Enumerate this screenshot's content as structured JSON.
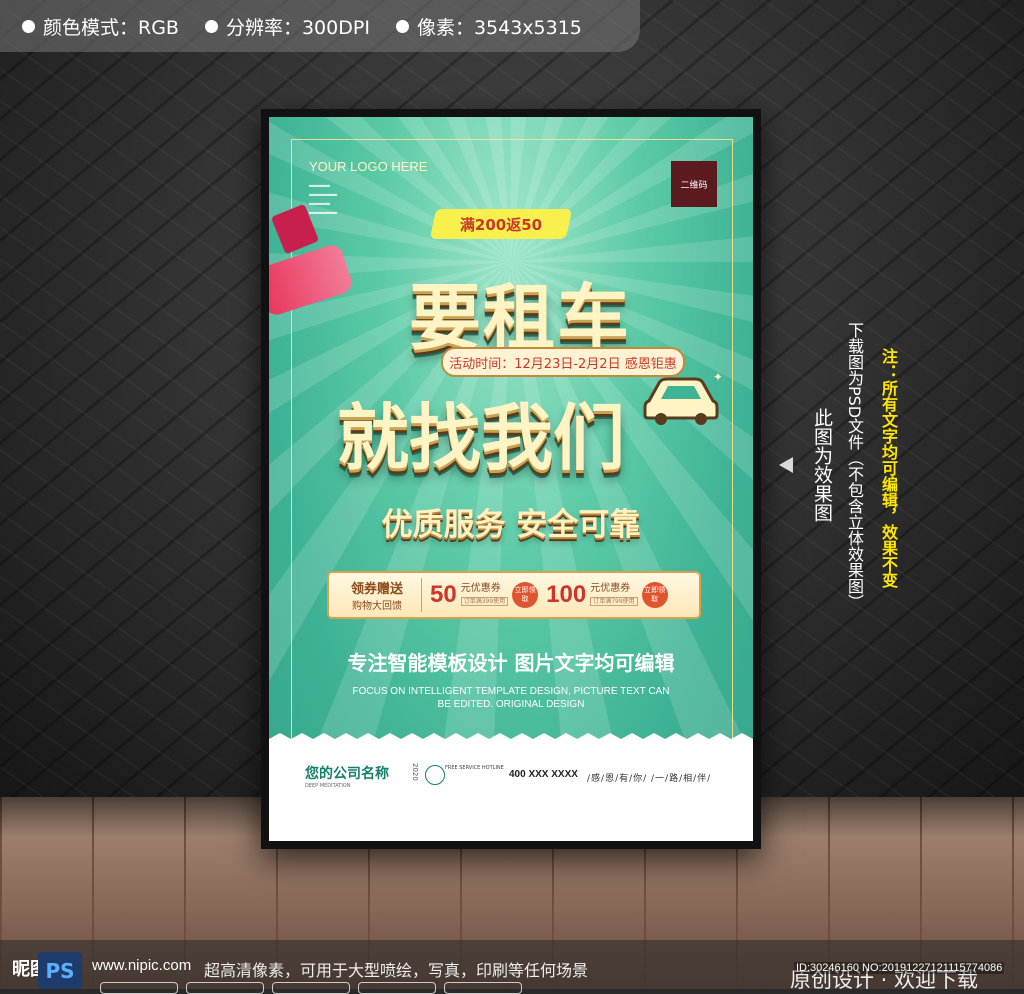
{
  "top_info": {
    "items": [
      {
        "label": "颜色模式：RGB"
      },
      {
        "label": "分辨率：300DPI"
      },
      {
        "label": "像素：3543x5315"
      }
    ]
  },
  "poster": {
    "logo": "YOUR LOGO HERE",
    "qr_label": "二维码",
    "promo_banner": "满200返50",
    "headline_line1": "要租车",
    "headline_line2": "就找我们",
    "activity_time": "活动时间：12月23日-2月2日 感恩钜惠",
    "slogan": "优质服务 安全可靠",
    "coupon": {
      "left_title": "领券赠送",
      "left_sub": "购物大回馈",
      "items": [
        {
          "amount": "50",
          "label": "元优惠券",
          "condition": "订单满399使用",
          "button": "立即领取"
        },
        {
          "amount": "100",
          "label": "元优惠券",
          "condition": "订单满799使用",
          "button": "立即领取"
        }
      ]
    },
    "tagline": "专注智能模板设计 图片文字均可编辑",
    "english_line1": "FOCUS ON INTELLIGENT TEMPLATE DESIGN, PICTURE TEXT CAN",
    "english_line2": "BE EDITED. ORIGINAL DESIGN",
    "footer": {
      "company": "您的公司名称",
      "company_en": "DEEP MEDITATION",
      "year": "2020",
      "hotline_label": "FREE SERVICE HOTLINE",
      "phone": "400 XXX XXXX",
      "thanks": "/感/恩/有/你/ /一/路/相/伴/"
    }
  },
  "side_notes": {
    "note_yellow": "注：所有文字均可编辑，效果不变",
    "note_download": "下载图为PSD文件（不包含立体效果图）",
    "note_effect": "此图为效果图"
  },
  "bottom": {
    "site_logo": "昵图网",
    "ps_badge": "PS",
    "url": "www.nipic.com",
    "description": "超高清像素，可用于大型喷绘，写真，印刷等任何场景",
    "original": "原创设计 · 欢迎下载",
    "id_text": "ID:30246160 NO:20191227121115774086"
  },
  "colors": {
    "poster_green": "#3fb395",
    "headline_cream": "#fff4c4",
    "promo_yellow": "#f9f04e",
    "promo_red": "#c7392c",
    "note_yellow": "#ffe600",
    "qr_bg": "#5a1a1e"
  }
}
